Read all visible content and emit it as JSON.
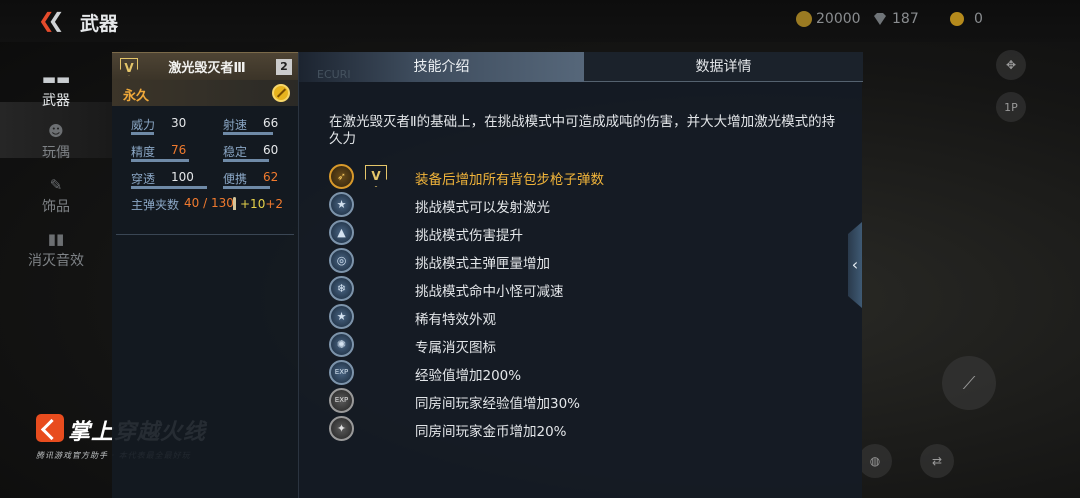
{
  "header": {
    "title": "武器",
    "coins": "20000",
    "gems": "187",
    "medals": "0"
  },
  "nav": {
    "items": [
      {
        "label": "武器",
        "active": true
      },
      {
        "label": "玩偶",
        "active": false
      },
      {
        "label": "饰品",
        "active": false
      },
      {
        "label": "消灭音效",
        "active": false
      }
    ]
  },
  "scene": {
    "slot_label": "1P"
  },
  "weapon": {
    "rank_badge": "V",
    "name": "激光毁灭者Ⅲ",
    "count": "2",
    "duration": "永久",
    "stats": [
      {
        "label": "威力",
        "value": "30",
        "highlight": false,
        "fill": 0.3
      },
      {
        "label": "射速",
        "value": "66",
        "highlight": false,
        "fill": 0.66
      },
      {
        "label": "精度",
        "value": "76",
        "highlight": true,
        "fill": 0.76
      },
      {
        "label": "稳定",
        "value": "60",
        "highlight": false,
        "fill": 0.6
      },
      {
        "label": "穿透",
        "value": "100",
        "highlight": false,
        "fill": 1.0
      },
      {
        "label": "便携",
        "value": "62",
        "highlight": true,
        "fill": 0.62
      }
    ],
    "magazine_label": "主弹夹数",
    "magazine_value": "40 / 130",
    "magazine_bonus_1": "+10",
    "magazine_bonus_2": "+2"
  },
  "tabs": {
    "ghost": "ECURI",
    "skills": "技能介绍",
    "data": "数据详情"
  },
  "skills": {
    "description": "在激光毁灭者Ⅱ的基础上，在挑战模式中可造成成吨的伤害，并大大增加激光模式的持久力",
    "items": [
      {
        "text": "装备后增加所有背包步枪子弹数",
        "icon": "rifle-icon",
        "glyph": "➶",
        "style": "gold",
        "badge": "V"
      },
      {
        "text": "挑战模式可以发射激光",
        "icon": "star-icon",
        "glyph": "★",
        "style": "blue"
      },
      {
        "text": "挑战模式伤害提升",
        "icon": "damage-up-icon",
        "glyph": "▲",
        "style": "blue"
      },
      {
        "text": "挑战模式主弹匣量增加",
        "icon": "magazine-icon",
        "glyph": "◎",
        "style": "blue"
      },
      {
        "text": "挑战模式命中小怪可减速",
        "icon": "slow-icon",
        "glyph": "❄",
        "style": "blue"
      },
      {
        "text": "稀有特效外观",
        "icon": "star-icon",
        "glyph": "★",
        "style": "blue"
      },
      {
        "text": "专属消灭图标",
        "icon": "kill-icon",
        "glyph": "✺",
        "style": "blue"
      },
      {
        "text": "经验值增加200%",
        "icon": "exp-icon",
        "glyph": "EXP",
        "style": "blue"
      },
      {
        "text": "同房间玩家经验值增加30%",
        "icon": "room-exp-icon",
        "glyph": "EXP",
        "style": "grey"
      },
      {
        "text": "同房间玩家金币增加20%",
        "icon": "room-coin-icon",
        "glyph": "✦",
        "style": "grey"
      }
    ]
  },
  "logo": {
    "title": "掌上穿越火线",
    "subtitle": "腾讯游戏官方助手 · 本代表最全最好玩"
  },
  "colors": {
    "accent": "#f07a2e",
    "gold": "#f1b43a",
    "stat_label": "#8aa6c4"
  }
}
